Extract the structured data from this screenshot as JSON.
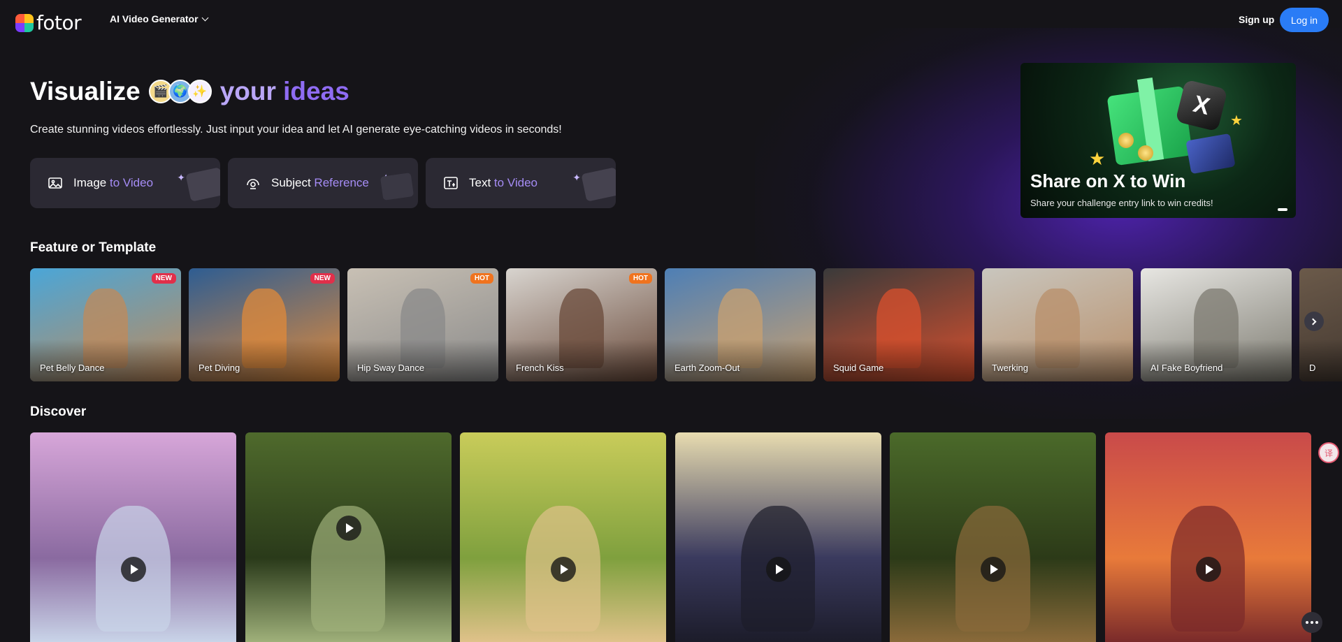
{
  "header": {
    "logo_text": "fotor",
    "nav_menu_label": "AI Video Generator",
    "signup_label": "Sign up",
    "login_label": "Log in"
  },
  "hero": {
    "title_part1": "Visualize",
    "title_part2": "your",
    "title_part3": "ideas",
    "emojis": [
      "🎬",
      "🌍",
      "✨"
    ],
    "subtitle": "Create stunning videos effortlessly. Just input your idea and let AI generate eye-catching videos in seconds!",
    "modes": [
      {
        "prefix": "Image",
        "accent": " to Video",
        "icon": "image-icon"
      },
      {
        "prefix": "Subject",
        "accent": " Reference",
        "icon": "subject-icon"
      },
      {
        "prefix": "Text",
        "accent": " to Video",
        "icon": "text-icon"
      }
    ]
  },
  "banner": {
    "title": "Share on X to Win",
    "subtitle": "Share your challenge entry link to win credits!",
    "x_glyph": "X"
  },
  "sections": {
    "templates_title": "Feature or Template",
    "discover_title": "Discover"
  },
  "templates": [
    {
      "label": "Pet Belly Dance",
      "badge": "NEW",
      "badge_type": "new",
      "colors": [
        "#4aa6d8",
        "#c08a5a"
      ]
    },
    {
      "label": "Pet Diving",
      "badge": "NEW",
      "badge_type": "new",
      "colors": [
        "#2e5d92",
        "#e08a3a"
      ]
    },
    {
      "label": "Hip Sway Dance",
      "badge": "HOT",
      "badge_type": "hot",
      "colors": [
        "#c8c0b4",
        "#8a8a8a"
      ]
    },
    {
      "label": "French Kiss",
      "badge": "HOT",
      "badge_type": "hot",
      "colors": [
        "#d8d4cf",
        "#6a4a3a"
      ]
    },
    {
      "label": "Earth Zoom-Out",
      "badge": "",
      "badge_type": "",
      "colors": [
        "#4e7fb5",
        "#c8a070"
      ]
    },
    {
      "label": "Squid Game",
      "badge": "",
      "badge_type": "",
      "colors": [
        "#3a3a3a",
        "#d9502e"
      ]
    },
    {
      "label": "Twerking",
      "badge": "",
      "badge_type": "",
      "colors": [
        "#c9c6be",
        "#b88f6a"
      ]
    },
    {
      "label": "AI Fake Boyfriend",
      "badge": "",
      "badge_type": "",
      "colors": [
        "#e7e6e2",
        "#7c7a70"
      ]
    },
    {
      "label": "D",
      "badge": "",
      "badge_type": "",
      "colors": [
        "#6b5a4a",
        "#3a302a"
      ]
    }
  ],
  "discover": [
    {
      "name": "pink-hair-girl",
      "colors": [
        "#d7a6d9",
        "#8a6aa0",
        "#c9d4e8"
      ],
      "has_play": true
    },
    {
      "name": "rabbit-flamingo",
      "colors": [
        "#4f6a2c",
        "#2a3a1a",
        "#9fb07a"
      ],
      "has_play": true
    },
    {
      "name": "crying-boy",
      "colors": [
        "#c9cc5a",
        "#7fa03e",
        "#e0c28a"
      ],
      "has_play": true
    },
    {
      "name": "alien-saxophone",
      "colors": [
        "#e8dcb0",
        "#3a3a5e",
        "#1c1c2a"
      ],
      "has_play": true
    },
    {
      "name": "capybara-guitar",
      "colors": [
        "#4b6a2a",
        "#2c3a18",
        "#8a6a3a"
      ],
      "has_play": true
    },
    {
      "name": "uluru-sunset",
      "colors": [
        "#c94a4a",
        "#e87a3a",
        "#7a2a2a"
      ],
      "has_play": true
    }
  ],
  "float_label": "译"
}
